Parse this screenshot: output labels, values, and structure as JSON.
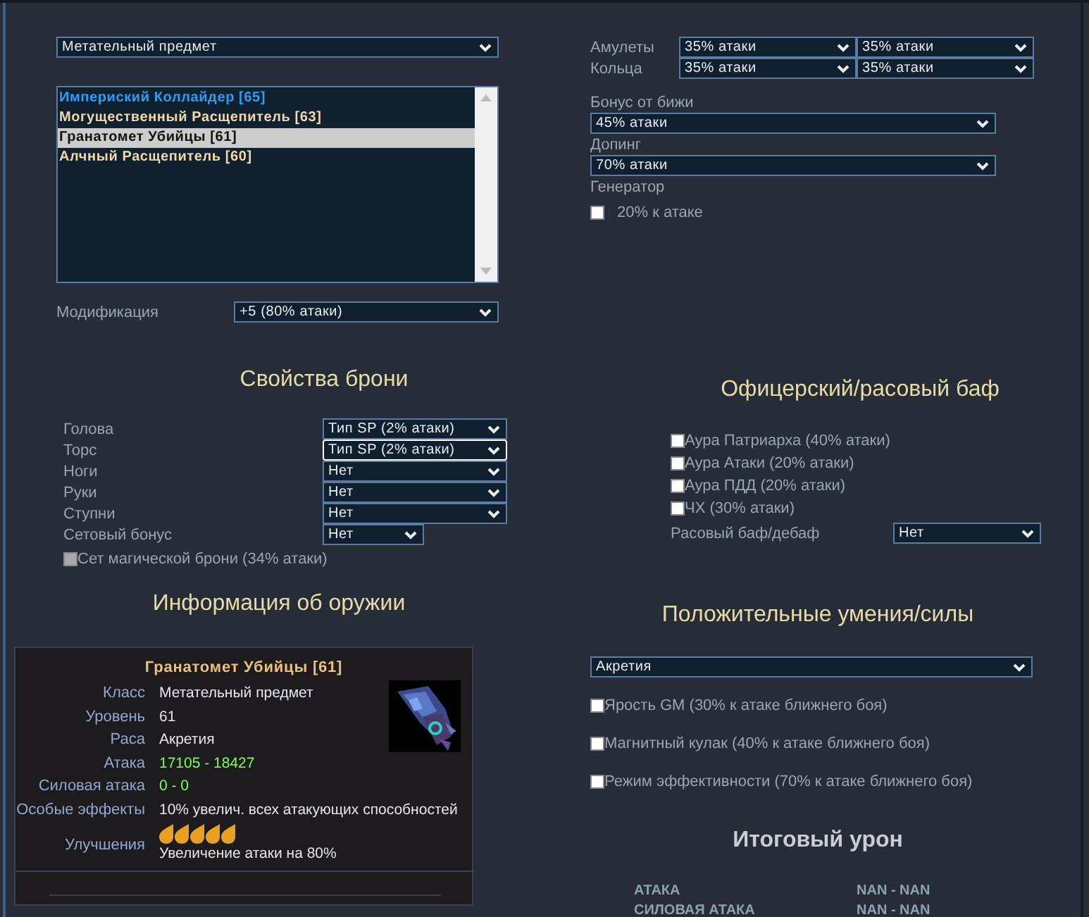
{
  "weapon": {
    "type_select": "Метательный предмет",
    "list": [
      {
        "label": "Империский Коллайдер [65]",
        "color": "#2a9df4",
        "selected": false
      },
      {
        "label": "Могущественный Расщепитель [63]",
        "color": "#f0d8a8",
        "selected": false
      },
      {
        "label": "Гранатомет Убийцы [61]",
        "selected": true
      },
      {
        "label": "Алчный Расщепитель [60]",
        "color": "#f0d8a8",
        "selected": false
      }
    ],
    "modification": {
      "label": "Модификация",
      "value": "+5 (80% атаки)"
    }
  },
  "jewelry": {
    "rows": [
      {
        "label": "Амулеты",
        "values": [
          "35% атаки",
          "35% атаки"
        ]
      },
      {
        "label": "Кольца",
        "values": [
          "35% атаки",
          "35% атаки"
        ]
      }
    ],
    "bonus": {
      "label": "Бонус от бижи",
      "value": "45% атаки"
    },
    "doping": {
      "label": "Допинг",
      "value": "70% атаки"
    },
    "generator": {
      "label": "Генератор",
      "option": {
        "label": "20% к атаке",
        "checked": false
      }
    }
  },
  "armor": {
    "title": "Свойства брони",
    "slots": [
      {
        "label": "Голова",
        "value": "Тип SP (2% атаки)",
        "focused": false
      },
      {
        "label": "Торс",
        "value": "Тип SP (2% атаки)",
        "focused": true
      },
      {
        "label": "Ноги",
        "value": "Нет",
        "focused": false
      },
      {
        "label": "Руки",
        "value": "Нет",
        "focused": false
      },
      {
        "label": "Ступни",
        "value": "Нет",
        "focused": false
      }
    ],
    "set_bonus": {
      "label": "Сетовый бонус",
      "value": "Нет"
    },
    "magic_set": {
      "label": "Сет магической брони (34% атаки)",
      "checked": false,
      "disabled": true
    }
  },
  "buffs": {
    "title": "Офицерский/расовый баф",
    "auras": [
      {
        "label": "Аура Патриарха (40% атаки)",
        "checked": false
      },
      {
        "label": "Аура Атаки (20% атаки)",
        "checked": false
      },
      {
        "label": "Аура ПДД (20% атаки)",
        "checked": false
      },
      {
        "label": "ЧХ (30% атаки)",
        "checked": false
      }
    ],
    "race": {
      "label": "Расовый баф/дебаф",
      "value": "Нет"
    }
  },
  "weapon_info": {
    "title": "Информация об оружии",
    "name": "Гранатомет Убийцы [61]",
    "rows": [
      {
        "label": "Класс",
        "value": "Метательный предмет",
        "kind": "text"
      },
      {
        "label": "Уровень",
        "value": "61",
        "kind": "text"
      },
      {
        "label": "Раса",
        "value": "Акретия",
        "kind": "text"
      },
      {
        "label": "Атака",
        "value": "17105 - 18427",
        "kind": "stat"
      },
      {
        "label": "Силовая атака",
        "value": "0 - 0",
        "kind": "stat"
      },
      {
        "label": "Особые эффекты",
        "value": "10% увелич. всех атакующих способностей",
        "kind": "text"
      }
    ],
    "upgrades": {
      "label": "Улучшения",
      "stars": 5,
      "description": "Увеличение атаки на 80%"
    }
  },
  "skills": {
    "title": "Положительные умения/силы",
    "race_select": "Акретия",
    "options": [
      {
        "label": "Ярость GM (30% к атаке ближнего боя)",
        "checked": false
      },
      {
        "label": "Магнитный кулак (40% к атаке ближнего боя)",
        "checked": false
      },
      {
        "label": "Режим эффективности (70% к атаке ближнего боя)",
        "checked": false
      }
    ]
  },
  "total": {
    "title": "Итоговый урон",
    "rows": [
      {
        "label": "АТАКА",
        "value": "NAN - NAN"
      },
      {
        "label": "СИЛОВАЯ АТАКА",
        "value": "NAN - NAN"
      }
    ]
  }
}
